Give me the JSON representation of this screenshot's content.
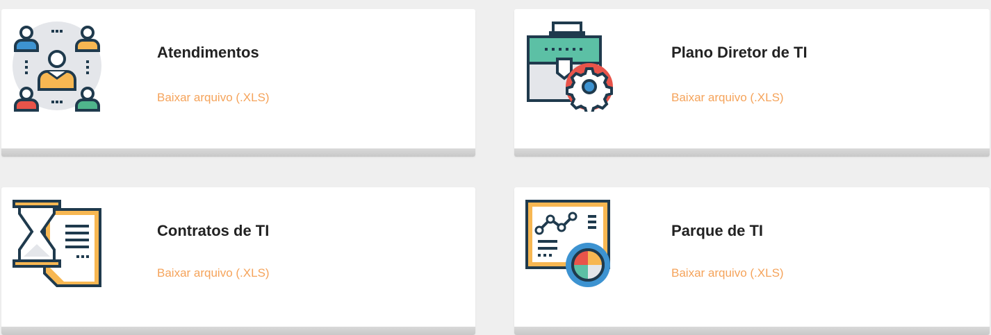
{
  "colors": {
    "background": "#efefef",
    "card": "#ffffff",
    "title": "#222222",
    "link": "#f5a35a",
    "icon_navy": "#1f3a4d",
    "icon_orange": "#f7b752",
    "icon_green": "#4fb58c",
    "icon_blue": "#3d93d1",
    "icon_red": "#e8544a",
    "icon_teal": "#5cc0a5"
  },
  "cards": [
    {
      "title": "Atendimentos",
      "link": "Baixar arquivo (.XLS)",
      "icon": "team-meeting-icon"
    },
    {
      "title": "Plano Diretor de TI",
      "link": "Baixar arquivo (.XLS)",
      "icon": "briefcase-gear-icon"
    },
    {
      "title": "Contratos de TI",
      "link": "Baixar arquivo (.XLS)",
      "icon": "hourglass-document-icon"
    },
    {
      "title": "Parque de TI",
      "link": "Baixar arquivo (.XLS)",
      "icon": "analytics-board-icon"
    }
  ]
}
